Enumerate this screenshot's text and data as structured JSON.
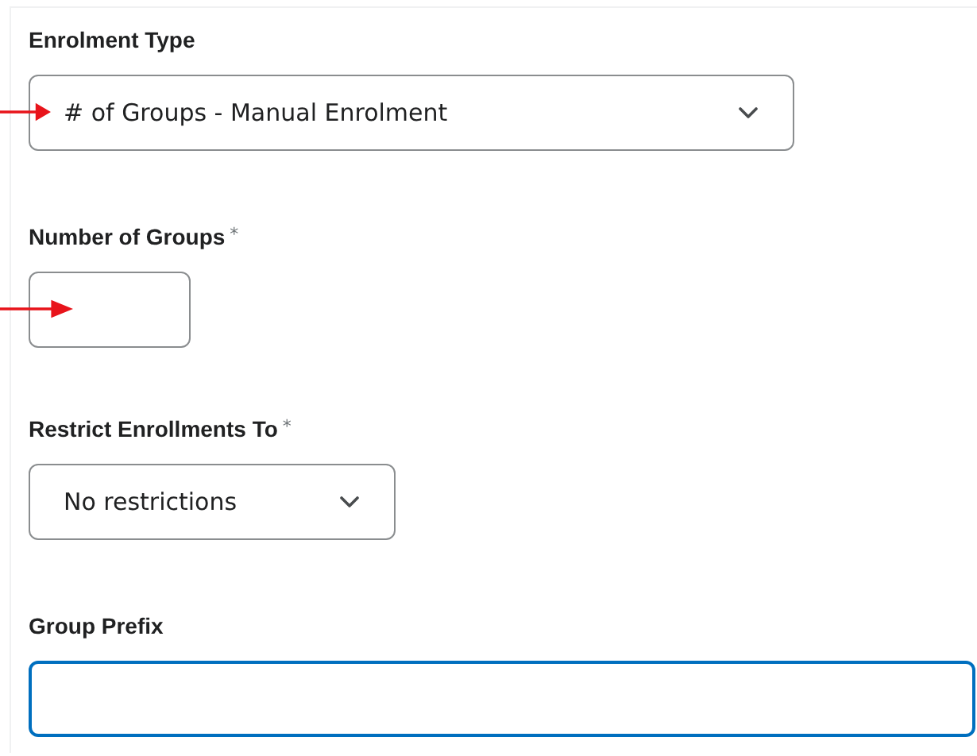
{
  "fields": [
    {
      "kind": "select",
      "label": "Enrolment Type",
      "value": "# of Groups - Manual Enrolment",
      "focused": false,
      "pointed_at": true
    },
    {
      "kind": "input",
      "label": "Number of Groups",
      "required": "*",
      "focused": false,
      "pointed_at": true
    },
    {
      "kind": "select",
      "label": "Restrict Enrollments To",
      "required": "*",
      "value": "No restrictions",
      "focused": false,
      "pointed_at": false
    },
    {
      "kind": "input",
      "label": "Group Prefix",
      "focused": true,
      "pointed_at": false
    }
  ]
}
